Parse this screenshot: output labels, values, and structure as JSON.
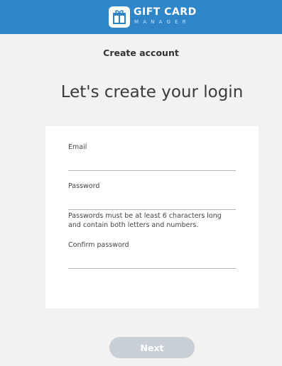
{
  "brand": {
    "name": "GIFT CARD",
    "subtitle": "MANAGER",
    "logo_icon": "gift-icon"
  },
  "page": {
    "step_title": "Create account",
    "heading": "Let's create your login"
  },
  "form": {
    "email": {
      "label": "Email",
      "value": "",
      "placeholder": ""
    },
    "password": {
      "label": "Password",
      "value": "",
      "placeholder": ""
    },
    "password_hint": "Passwords must be at least 6 characters long and contain both letters and numbers.",
    "confirm_password": {
      "label": "Confirm password",
      "value": "",
      "placeholder": ""
    }
  },
  "actions": {
    "next_label": "Next"
  },
  "colors": {
    "header_bg": "#2e86c9",
    "page_bg": "#f2f2f2",
    "card_bg": "#ffffff",
    "button_disabled_bg": "#c9cfd6"
  }
}
